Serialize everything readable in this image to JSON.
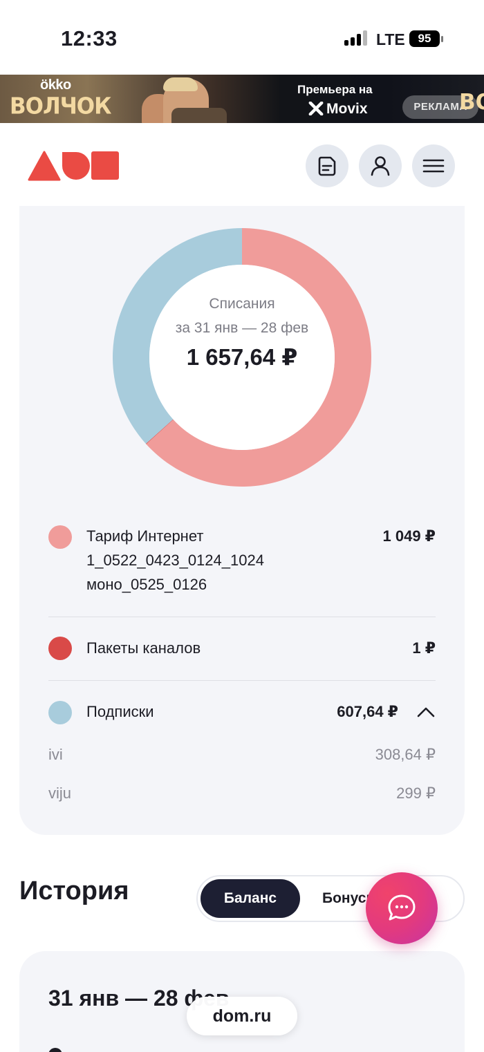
{
  "status_bar": {
    "time": "12:33",
    "network": "LTE",
    "battery": "95"
  },
  "ad_banner": {
    "brand": "ökko",
    "movie_title": "ВОЛЧОК",
    "premiere_text": "Премьера на",
    "partner": "Movix",
    "ad_label": "РЕКЛАМА",
    "edge_text": "ВО"
  },
  "header": {
    "logo": "dom-ru-logo",
    "buttons": [
      "document-icon",
      "user-icon",
      "menu-icon"
    ]
  },
  "charges": {
    "caption": "Списания",
    "period": "за 31 янв — 28 фев",
    "total": "1 657,64 ₽",
    "items": [
      {
        "label_lines": [
          "Тариф Интернет",
          "1_0522_0423_0124_1024",
          "моно_0525_0126"
        ],
        "value": "1 049 ₽",
        "amount": 1049,
        "color": "#f09c9a"
      },
      {
        "label_lines": [
          "Пакеты каналов"
        ],
        "value": "1 ₽",
        "amount": 1,
        "color": "#d94a48"
      },
      {
        "label_lines": [
          "Подписки"
        ],
        "value": "607,64 ₽",
        "amount": 607.64,
        "color": "#a8ccdc",
        "expanded": true,
        "sub_items": [
          {
            "label": "ivi",
            "value": "308,64 ₽"
          },
          {
            "label": "viju",
            "value": "299 ₽"
          }
        ]
      }
    ]
  },
  "history": {
    "title": "История",
    "tabs": [
      {
        "label": "Баланс",
        "active": true
      },
      {
        "label": "Бонусы",
        "active": false
      }
    ],
    "card_period": "31 янв — 28 фев"
  },
  "chat_button": "chat-bubble-icon",
  "url_bar": {
    "domain": "dom.ru"
  },
  "colors": {
    "accent_red": "#ea4b44",
    "dark_navy": "#1d1f33",
    "card_bg": "#f4f5f9",
    "fab_pink": "#e33a7e"
  }
}
